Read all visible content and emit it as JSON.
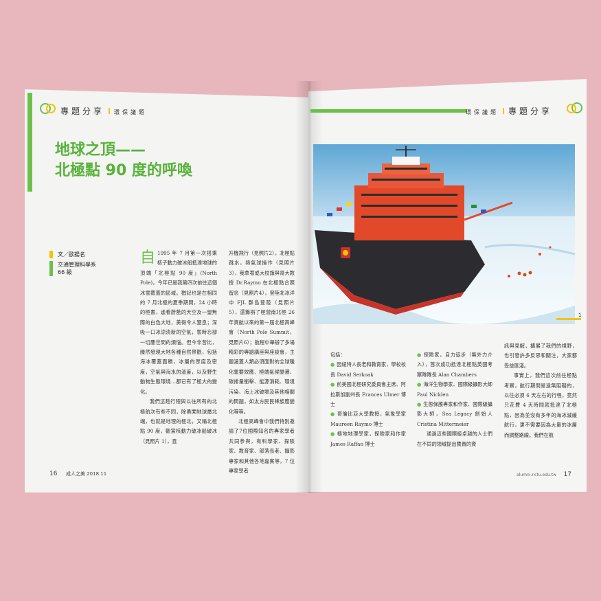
{
  "left": {
    "header_big": "專題分享",
    "header_small": "環保議題",
    "title_line1": "地球之頂——",
    "title_line2": "北極點 90 度的呼喚",
    "byline_author": "文／歐揚名",
    "byline_dept": "交通管理科學系",
    "byline_class": "66 級",
    "col1_dropcap": "自",
    "col1_text": "1995 年 7 月第一次搭乘核子動力破冰船抵達地球的頂端「北極點 90 度」(North Pole)，今年已是我第四次前往這個冰雪覆蓋的區域。猶記也是在相同的 7 月北極的夏季期間，24 小時的極晝，遙看蔚藍的天空及一望無際的白色大地，美得令人窒息；深吸一口冰涼清新的空氣，暫時忘卻一切塵世間的煩惱。但今非昔比，滕然發現大地各種自然景觀，包括海冰覆蓋面積，冰層的厚度及密度，空氣與海水的溫度，以及野生動物生態環境…都已有了極大的變化。",
    "col1_text2": "我們這趟行程與以往所有的北極航次有些不同，除勇闖地球最北端，也就是地理的極北，又稱北極點 90 度，觀賞核動力破冰船破冰（見照片 1），直",
    "col2_text": "升機飛行（見照片2），北極點跳水，熱氣球操作（見照片3），我拿著或大校旗與哥大教授 Dr.Raymo 在北極點合照留念（見照片4），登陸北冰洋中 FJL 群島登陸（見照片5），還籌辦了極營南北極 26 年資航以來的第一屆北極高峰會（North Pole Summit，見照片6）；航程中舉辦了多場精彩的專題講座與座談會，主題涵蓋人類必須面對的全球暖化重要效應、極端氣候變遷、碳排量衝擊、能源消耗、環境污染、海上冰破壞及其他相關的問題，如太方民民稀族應變化等等。",
    "col2_text2": "北極高峰會中我們特別邀請了7位國際知名的專家學者共同參與，有科學家、探險家、教育家、部落長老、攝影專家和其他各地嘉賓等，7 位專家學者",
    "folio_num": "16",
    "folio_text": "成人之美 2018.11"
  },
  "right": {
    "header_big": "專題分享",
    "header_small": "環保議題",
    "photo_number": "1",
    "col1_intro": "包括：",
    "col1_items": [
      "因紐特人長老和教育家，學校校長 David Serkoak",
      "前美國北極研究委員會主席、阿拉斯加副州長 Frances Ulmer 博士",
      "哥倫比亞大學教授，氣象學家 Maureen Raymo 博士",
      "極地地理學家，探險家和作家 James Raffan 博士"
    ],
    "col2_items": [
      "探險家，自力徒步（無外力介入），首次成功抵達北極點英國考察隊隊長 Alan Chambers",
      "海洋生物學家、國際級攝影大師 Paul Nicklen",
      "生態保護專家和作家、國際級攝影大師，Sea Legacy 創始人 Cristina Mittermeier"
    ],
    "col2_tail": "通過這些國際級卓越的人士們在不同的領域提出寶貴的資",
    "col3_text": "訊與見解，擴展了我們的視野，也引發許多反思和關注，大家都受益匪淺。",
    "col3_text2": "事實上，我們這次前往極點考察，航行期間是遠無阻礙的，以往必須 6 天左右的行程，竟然只花費 4 天時間就抵達了北極點，因為並沒有多年的海冰減緩航行，更不需要因為大量的冰層而調整路線。我們在航",
    "folio_site": "alumni.nctu.edu.tw",
    "folio_num": "17"
  },
  "colors": {
    "green": "#6cc04a",
    "yellow": "#f2c400",
    "background": "#e8b7bd",
    "hull_red": "#e2492a"
  }
}
